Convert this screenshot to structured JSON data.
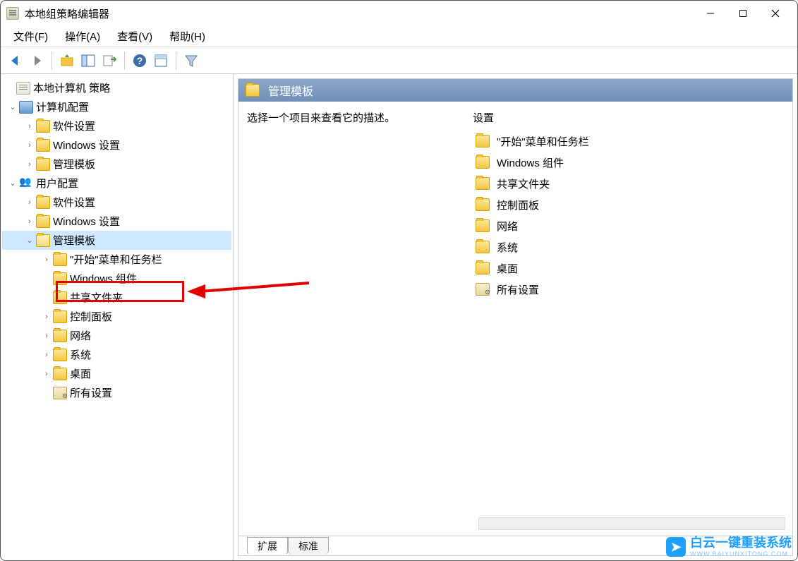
{
  "window": {
    "title": "本地组策略编辑器"
  },
  "menu": {
    "file": "文件(F)",
    "action": "操作(A)",
    "view": "查看(V)",
    "help": "帮助(H)"
  },
  "tree": {
    "root": "本地计算机 策略",
    "computer_cfg": "计算机配置",
    "computer_children": {
      "software": "软件设置",
      "windows": "Windows 设置",
      "admin_templates": "管理模板"
    },
    "user_cfg": "用户配置",
    "user_children": {
      "software": "软件设置",
      "windows": "Windows 设置",
      "admin_templates": "管理模板"
    },
    "admin_template_children": {
      "start_menu": "\"开始\"菜单和任务栏",
      "windows_components": "Windows 组件",
      "shared_folders": "共享文件夹",
      "control_panel": "控制面板",
      "network": "网络",
      "system": "系统",
      "desktop": "桌面",
      "all_settings": "所有设置"
    }
  },
  "content": {
    "header": "管理模板",
    "description": "选择一个项目来查看它的描述。",
    "list_header": "设置",
    "items": {
      "start_menu": "\"开始\"菜单和任务栏",
      "windows_components": "Windows 组件",
      "shared_folders": "共享文件夹",
      "control_panel": "控制面板",
      "network": "网络",
      "system": "系统",
      "desktop": "桌面",
      "all_settings": "所有设置"
    }
  },
  "tabs": {
    "extended": "扩展",
    "standard": "标准"
  },
  "watermark": {
    "text": "白云一键重装系统",
    "sub": "WWW.BAIYUNXITONG.COM"
  }
}
